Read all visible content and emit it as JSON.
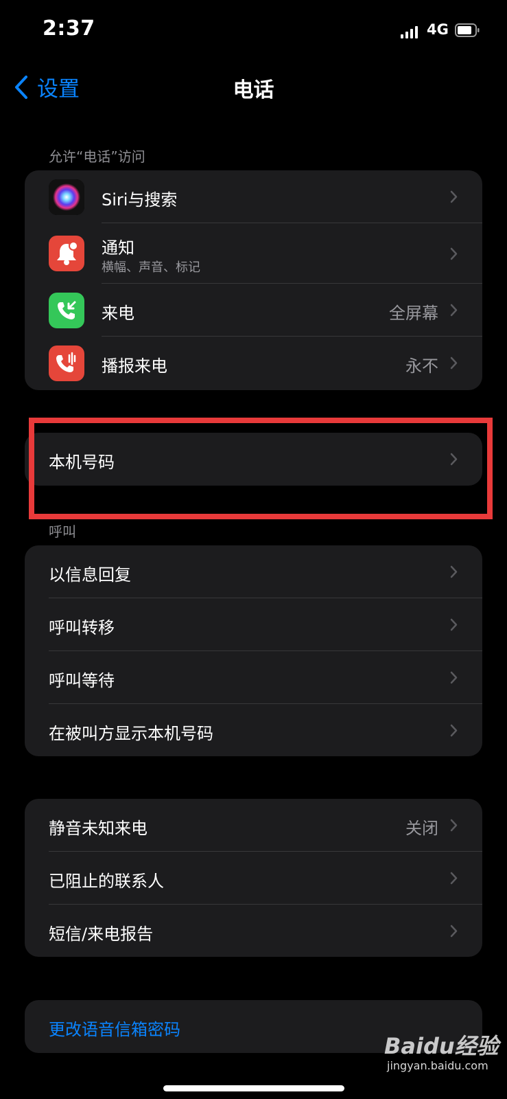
{
  "status_bar": {
    "time": "2:37",
    "network": "4G",
    "signal_icon": "signal-bars-icon",
    "battery_icon": "battery-icon"
  },
  "nav": {
    "back_label": "设置",
    "title": "电话"
  },
  "section_access": {
    "header": "允许“电话”访问",
    "rows": [
      {
        "label": "Siri与搜索",
        "icon": "siri-icon"
      },
      {
        "label": "通知",
        "sub": "横幅、声音、标记",
        "icon": "notification-bell-icon",
        "icon_color": "#e5463a"
      },
      {
        "label": "来电",
        "value": "全屏幕",
        "icon": "incoming-call-icon",
        "icon_color": "#34c759"
      },
      {
        "label": "播报来电",
        "value": "永不",
        "icon": "announce-call-icon",
        "icon_color": "#e5463a"
      }
    ]
  },
  "my_number": {
    "label": "本机号码"
  },
  "section_calls": {
    "header": "呼叫",
    "rows": [
      {
        "label": "以信息回复"
      },
      {
        "label": "呼叫转移"
      },
      {
        "label": "呼叫等待"
      },
      {
        "label": "在被叫方显示本机号码"
      }
    ]
  },
  "section_block": {
    "rows": [
      {
        "label": "静音未知来电",
        "value": "关闭"
      },
      {
        "label": "已阻止的联系人"
      },
      {
        "label": "短信/来电报告"
      }
    ]
  },
  "voicemail": {
    "label": "更改语音信箱密码"
  },
  "watermark": {
    "logo": "Baidu经验",
    "site": "jingyan.baidu.com"
  },
  "colors": {
    "accent": "#0a84ff",
    "highlight": "#e83a3a",
    "cell_bg": "#1c1c1e"
  }
}
